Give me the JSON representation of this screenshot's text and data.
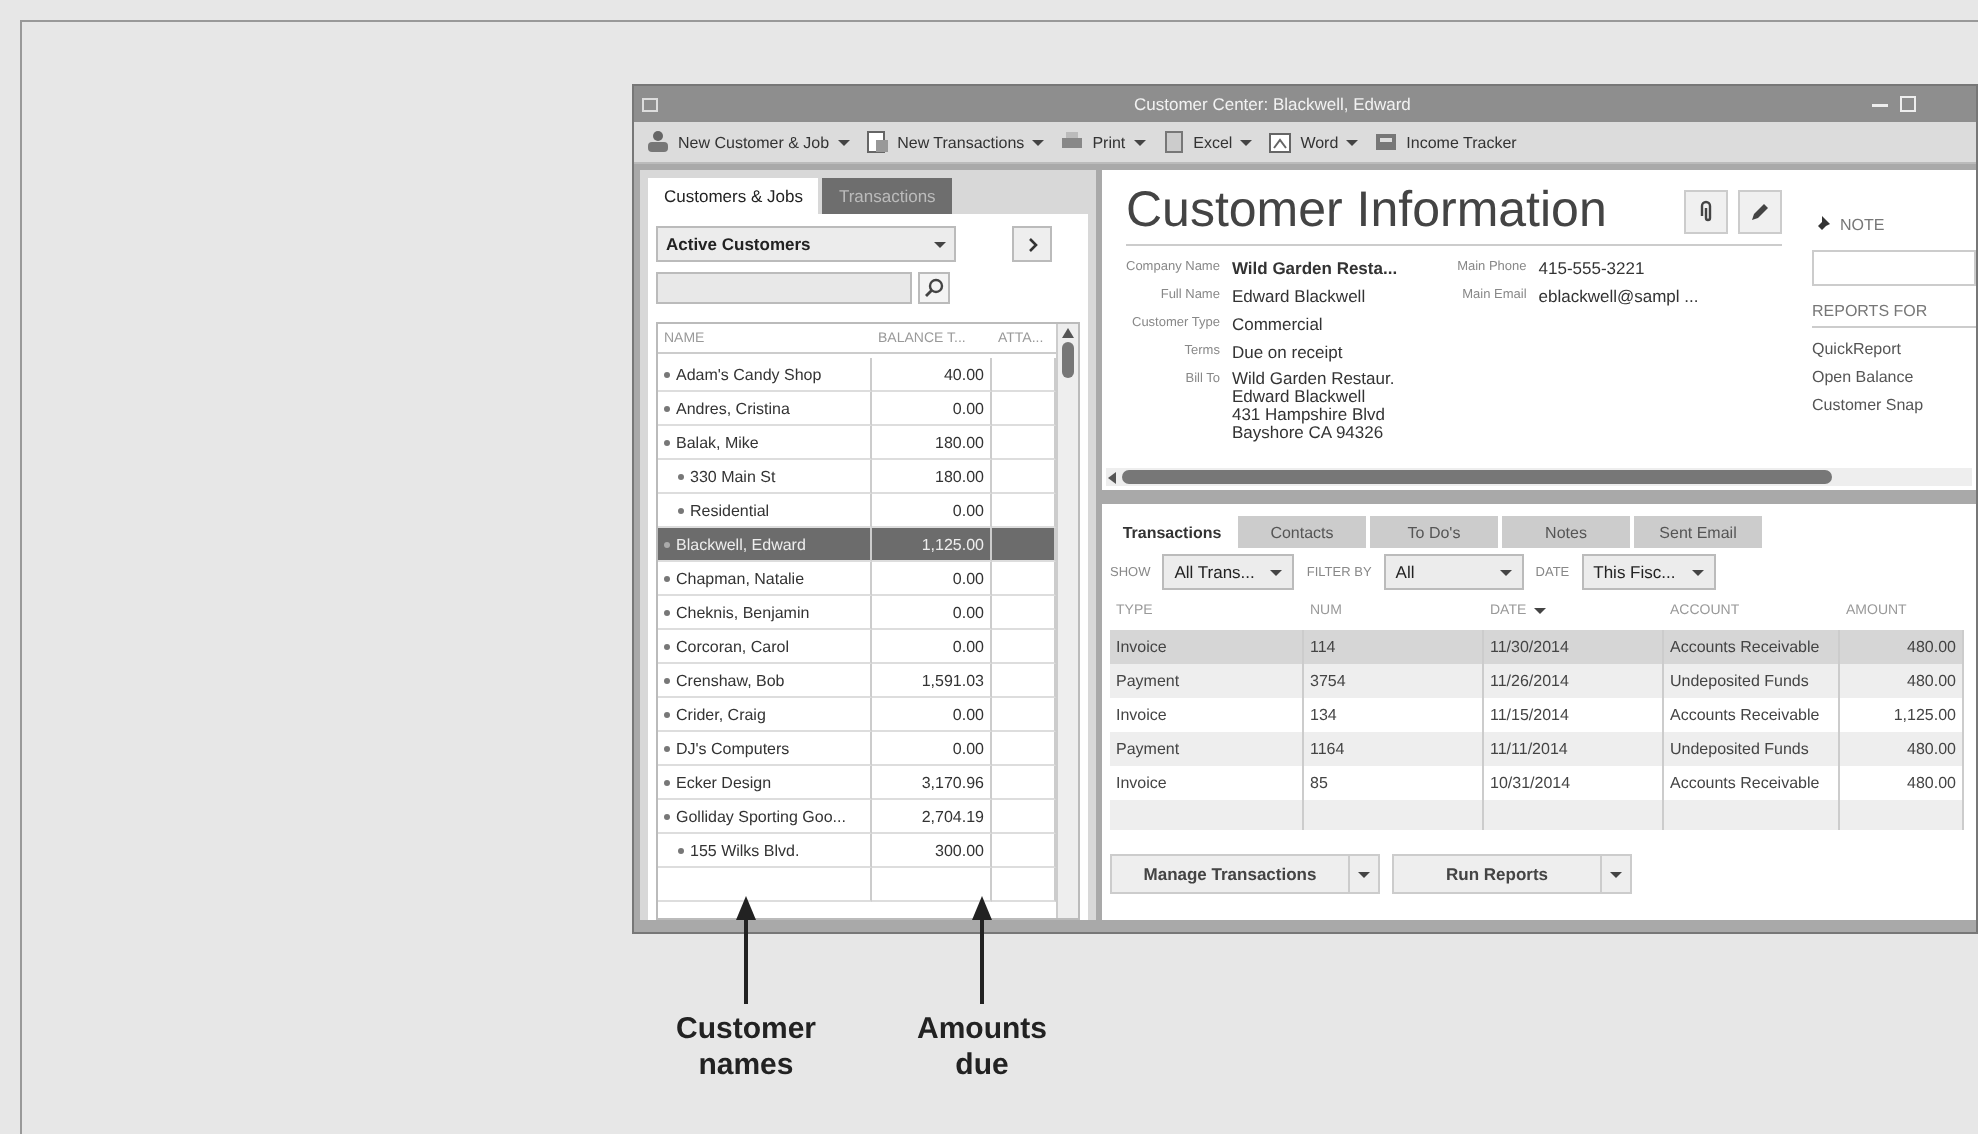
{
  "window": {
    "title": "Customer Center: Blackwell, Edward"
  },
  "toolbar": [
    {
      "label": "New Customer & Job",
      "kind": "person",
      "dropdown": true
    },
    {
      "label": "New Transactions",
      "kind": "form",
      "dropdown": true
    },
    {
      "label": "Print",
      "kind": "printer",
      "dropdown": true
    },
    {
      "label": "Excel",
      "kind": "sheet",
      "dropdown": true
    },
    {
      "label": "Word",
      "kind": "doc",
      "dropdown": true
    },
    {
      "label": "Income Tracker",
      "kind": "tracker",
      "dropdown": false
    }
  ],
  "left_tabs": [
    {
      "label": "Customers & Jobs",
      "selected": true
    },
    {
      "label": "Transactions",
      "selected": false
    }
  ],
  "customer_filter": {
    "value": "Active Customers"
  },
  "customer_table": {
    "columns": [
      "NAME",
      "BALANCE T...",
      "ATTA..."
    ],
    "rows": [
      {
        "name": "Adam's Candy Shop",
        "balance": "40.00",
        "selected": false
      },
      {
        "name": "Andres, Cristina",
        "balance": "0.00",
        "selected": false
      },
      {
        "name": "Balak, Mike",
        "balance": "180.00",
        "selected": false,
        "children": [
          {
            "name": "330 Main St",
            "balance": "180.00",
            "selected": false
          },
          {
            "name": "Residential",
            "balance": "0.00",
            "selected": false
          }
        ]
      },
      {
        "name": "Blackwell, Edward",
        "balance": "1,125.00",
        "selected": true
      },
      {
        "name": "Chapman, Natalie",
        "balance": "0.00",
        "selected": false
      },
      {
        "name": "Cheknis, Benjamin",
        "balance": "0.00",
        "selected": false
      },
      {
        "name": "Corcoran, Carol",
        "balance": "0.00",
        "selected": false
      },
      {
        "name": "Crenshaw, Bob",
        "balance": "1,591.03",
        "selected": false
      },
      {
        "name": "Crider, Craig",
        "balance": "0.00",
        "selected": false
      },
      {
        "name": "DJ's Computers",
        "balance": "0.00",
        "selected": false
      },
      {
        "name": "Ecker Design",
        "balance": "3,170.96",
        "selected": false
      },
      {
        "name": "Golliday Sporting Goo...",
        "balance": "2,704.19",
        "selected": false,
        "children": [
          {
            "name": "155 Wilks Blvd.",
            "balance": "300.00",
            "selected": false
          }
        ]
      }
    ]
  },
  "customer_info": {
    "title": "Customer Information",
    "fields_left": [
      {
        "label": "Company Name",
        "kind": "text",
        "value": "Wild Garden Resta...",
        "bold": true
      },
      {
        "label": "Full Name",
        "kind": "text",
        "value": "Edward  Blackwell",
        "bold": false
      },
      {
        "label": "Customer Type",
        "kind": "text",
        "value": "Commercial",
        "bold": false
      },
      {
        "label": "Terms",
        "kind": "text",
        "value": "Due on receipt",
        "bold": false
      },
      {
        "label": "Bill To",
        "kind": "address",
        "lines": [
          "Wild Garden Restaur.",
          "Edward Blackwell",
          "431 Hampshire Blvd",
          "Bayshore CA 94326"
        ],
        "bold": false
      }
    ],
    "fields_right": [
      {
        "label": "Main Phone",
        "value": "415-555-3221"
      },
      {
        "label": "Main Email",
        "value": "eblackwell@sampl  ..."
      }
    ]
  },
  "note": {
    "title": "NOTE"
  },
  "reports": {
    "title": "REPORTS FOR",
    "links": [
      "QuickReport",
      "Open Balance",
      "Customer Snap"
    ]
  },
  "detail_tabs": [
    {
      "label": "Transactions",
      "selected": true
    },
    {
      "label": "Contacts",
      "selected": false
    },
    {
      "label": "To Do's",
      "selected": false
    },
    {
      "label": "Notes",
      "selected": false
    },
    {
      "label": "Sent Email",
      "selected": false
    }
  ],
  "filters": [
    {
      "label": "SHOW",
      "value": "All Trans..."
    },
    {
      "label": "FILTER BY",
      "value": "All"
    },
    {
      "label": "DATE",
      "value": "This Fisc..."
    }
  ],
  "transactions": {
    "columns": [
      {
        "label": "TYPE",
        "sorted": false
      },
      {
        "label": "NUM",
        "sorted": false
      },
      {
        "label": "DATE",
        "sorted": true
      },
      {
        "label": "ACCOUNT",
        "sorted": false
      },
      {
        "label": "AMOUNT",
        "sorted": false
      }
    ],
    "rows": [
      {
        "cells": [
          "Invoice",
          "114",
          "11/30/2014",
          "Accounts Receivable",
          "480.00"
        ],
        "selected": true
      },
      {
        "cells": [
          "Payment",
          "3754",
          "11/26/2014",
          "Undeposited Funds",
          "480.00"
        ],
        "selected": false
      },
      {
        "cells": [
          "Invoice",
          "134",
          "11/15/2014",
          "Accounts Receivable",
          "1,125.00"
        ],
        "selected": false
      },
      {
        "cells": [
          "Payment",
          "1164",
          "11/11/2014",
          "Undeposited Funds",
          "480.00"
        ],
        "selected": false
      },
      {
        "cells": [
          "Invoice",
          "85",
          "10/31/2014",
          "Accounts Receivable",
          "480.00"
        ],
        "selected": false
      }
    ]
  },
  "buttons": [
    {
      "label": "Manage Transactions"
    },
    {
      "label": "Run Reports"
    }
  ],
  "callouts": [
    {
      "label": "Customer names"
    },
    {
      "label": "Amounts due"
    }
  ]
}
